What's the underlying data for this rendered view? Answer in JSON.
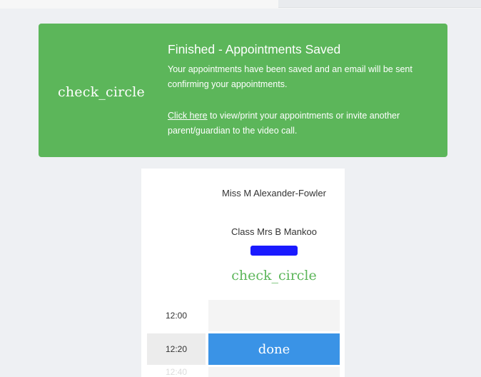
{
  "banner": {
    "icon": "check_circle",
    "title": "Finished - Appointments Saved",
    "message": "Your appointments have been saved and an email will be sent confirming your appointments.",
    "link_text": "Click here",
    "link_suffix": " to view/print your appointments or invite another parent/guardian to the video call.",
    "color": "#5cb65a"
  },
  "card": {
    "teacher_name": "Miss M Alexander-Fowler",
    "class_label": "Class Mrs B Mankoo",
    "status_icon": "check_circle",
    "slots": [
      {
        "time": "12:00",
        "state": ""
      },
      {
        "time": "12:20",
        "state": "done"
      },
      {
        "time": "12:40",
        "state": ""
      }
    ],
    "booked_color": "#3a93e6"
  }
}
